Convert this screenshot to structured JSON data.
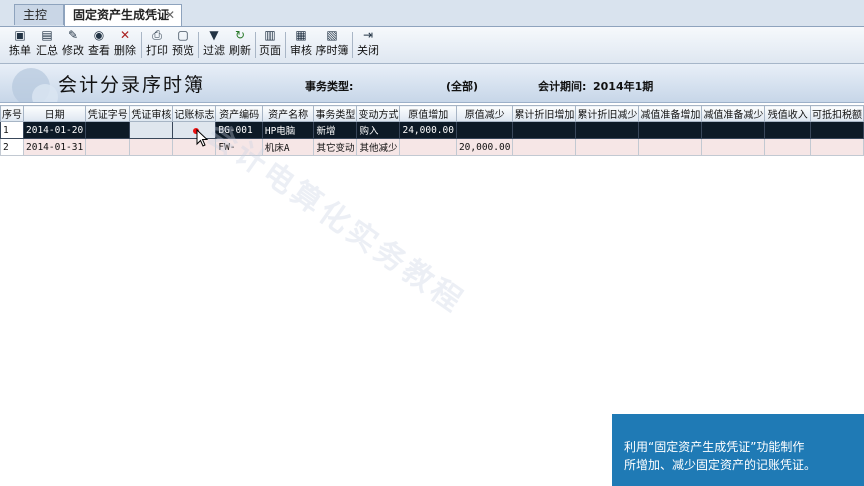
{
  "tabs": [
    {
      "label": "主控台"
    },
    {
      "label": "固定资产生成凭证",
      "close": "✕"
    }
  ],
  "toolbar": {
    "items": [
      {
        "label": "拣单",
        "icon": "pick-icon"
      },
      {
        "label": "汇总",
        "icon": "summary-icon"
      },
      {
        "label": "修改",
        "icon": "edit-icon"
      },
      {
        "label": "查看",
        "icon": "binoculars-icon"
      },
      {
        "label": "删除",
        "icon": "delete-icon"
      },
      {
        "label": "打印",
        "icon": "print-icon"
      },
      {
        "label": "预览",
        "icon": "preview-icon"
      },
      {
        "label": "过滤",
        "icon": "filter-icon"
      },
      {
        "label": "刷新",
        "icon": "refresh-icon"
      },
      {
        "label": "页面",
        "icon": "page-icon"
      },
      {
        "label": "审核",
        "icon": "audit-icon"
      },
      {
        "label": "序时簿",
        "icon": "journal-icon"
      },
      {
        "label": "关闭",
        "icon": "close-icon"
      }
    ]
  },
  "header": {
    "title": "会计分录序时簿",
    "type_label": "事务类型:",
    "type_value": "(全部)",
    "period_label": "会计期间:",
    "period_value": "2014年1期"
  },
  "table": {
    "columns": [
      "序号",
      "日期",
      "凭证字号",
      "凭证审核",
      "记账标志",
      "资产编码",
      "资产名称",
      "事务类型",
      "变动方式",
      "原值增加",
      "原值减少",
      "累计折旧增加",
      "累计折旧减少",
      "减值准备增加",
      "减值准备减少",
      "残值收入",
      "可抵扣税额"
    ],
    "rows": [
      [
        "1",
        "2014-01-20",
        "",
        "",
        "",
        "BG-001",
        "HP电脑",
        "新增",
        "购入",
        "24,000.00",
        "",
        "",
        "",
        "",
        "",
        "",
        ""
      ],
      [
        "2",
        "2014-01-31",
        "",
        "",
        "",
        "FW-",
        "机床A",
        "其它变动",
        "其他减少",
        "",
        "20,000.00",
        "",
        "",
        "",
        "",
        "",
        ""
      ]
    ]
  },
  "watermark": "会计电算化实务教程",
  "note": {
    "line1": "利用“固定资产生成凭证”功能制作",
    "line2": "所增加、减少固定资产的记账凭证。"
  },
  "colors": {
    "selected_row": "#0d1a26",
    "row2_bg": "#f6e6e6",
    "note_bg": "#1f7ab5"
  }
}
